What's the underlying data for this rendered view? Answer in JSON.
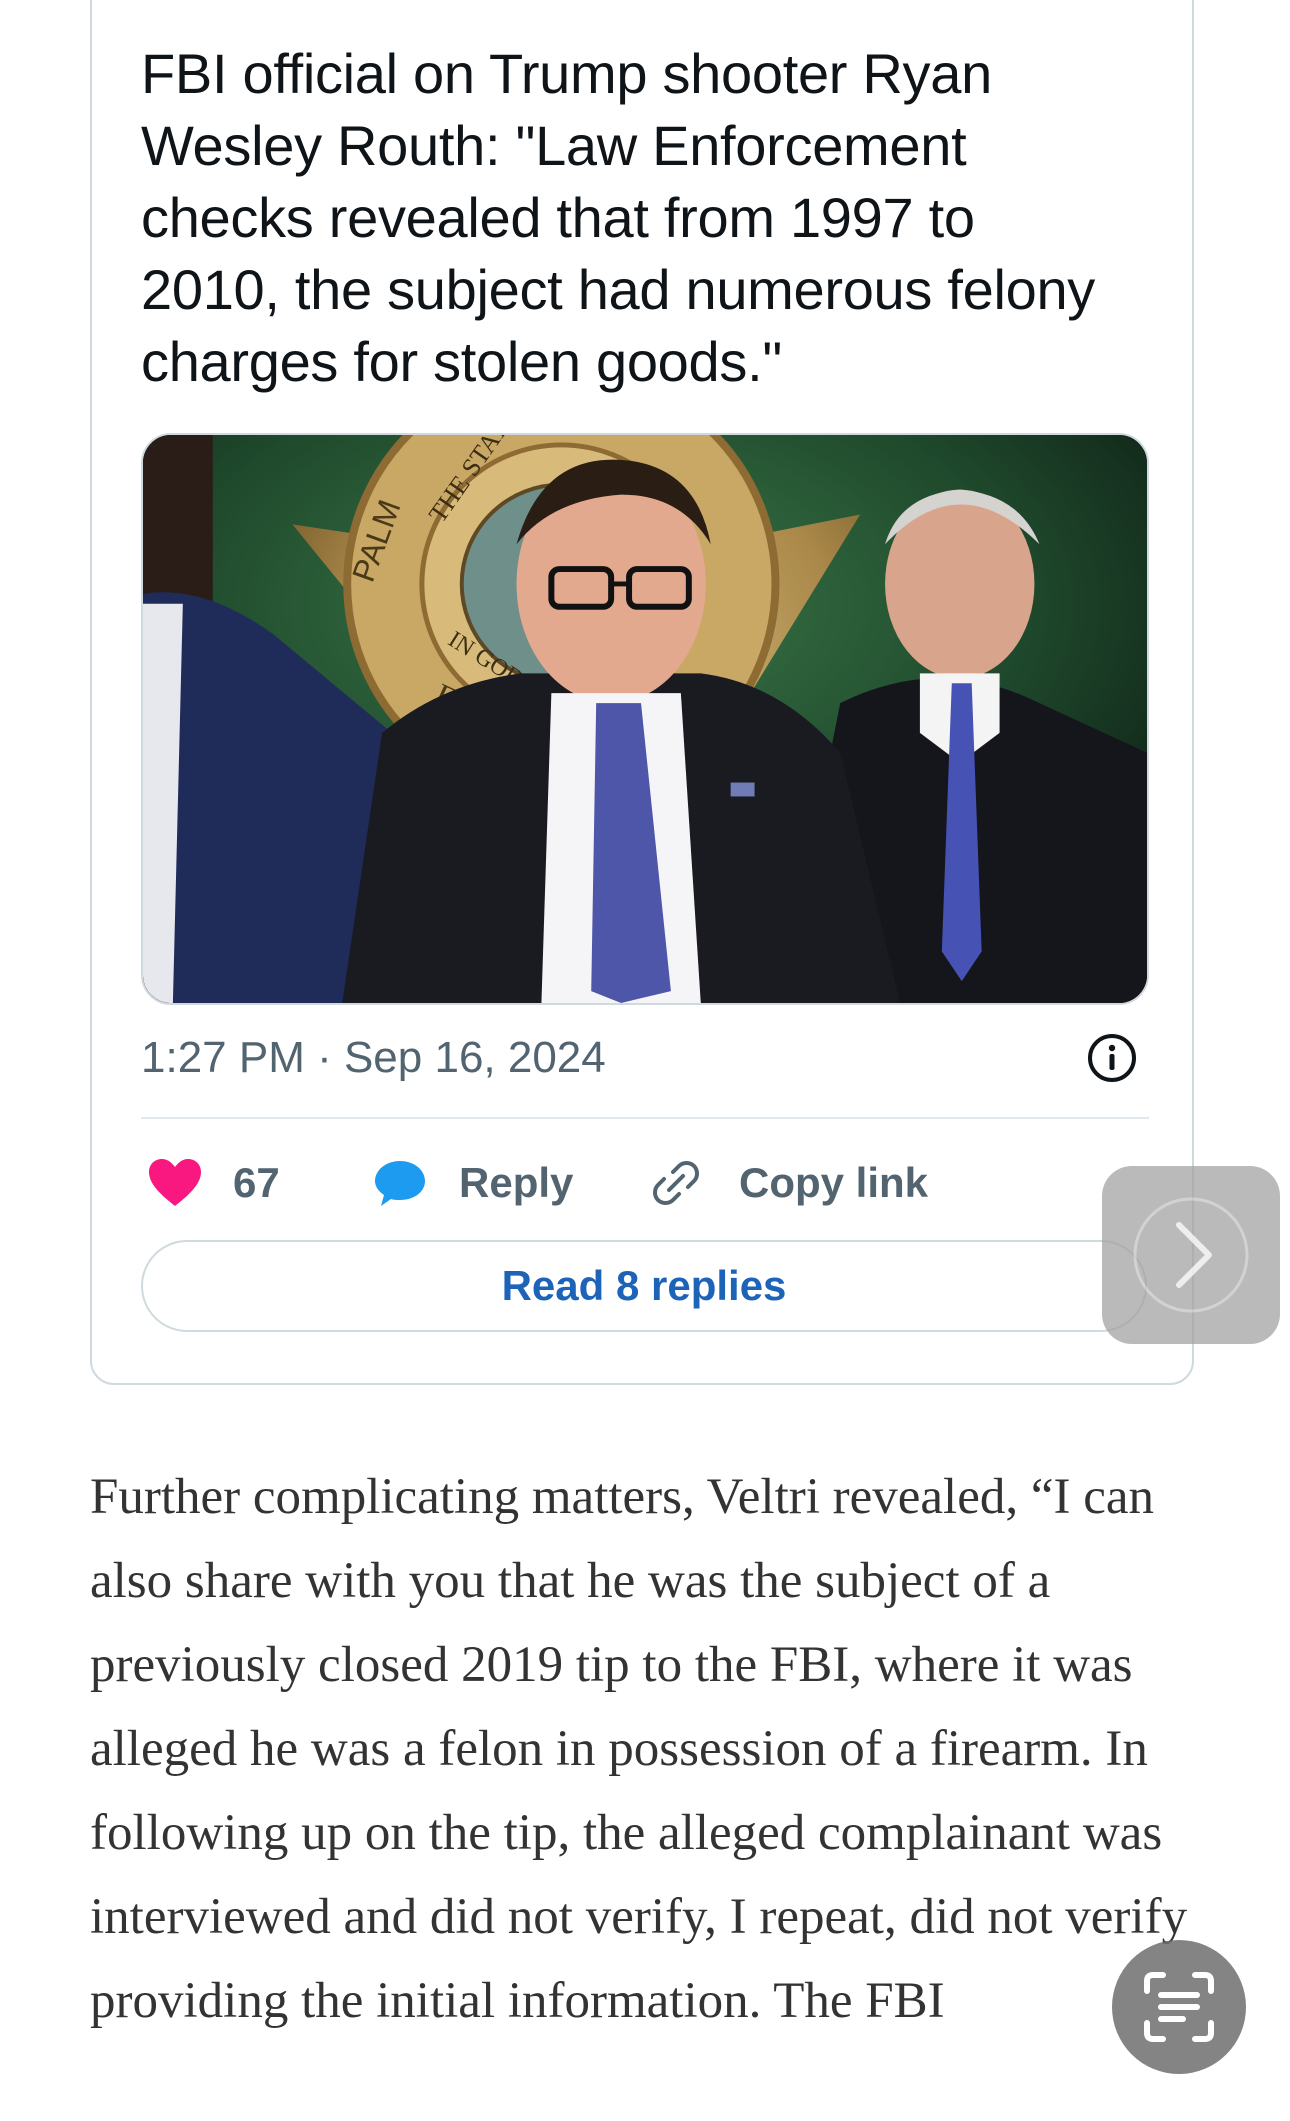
{
  "tweet": {
    "text": "FBI official on Trump shooter Ryan Wesley Routh: \"Law Enforcement checks revealed that from 1997 to 2010, the subject had numerous felony charges for stolen goods.\"",
    "timestamp": "1:27 PM · Sep 16, 2024",
    "media_icon": "press-conference-photo",
    "info_icon": "info-icon",
    "actions": {
      "like_count": "67",
      "reply_label": "Reply",
      "copy_link_label": "Copy link"
    },
    "read_replies_label": "Read 8 replies",
    "colors": {
      "like": "#f91880",
      "reply": "#1d9bf0",
      "read_replies": "#1d63b8",
      "secondary_text": "#536471",
      "border": "#cfd9de"
    }
  },
  "article": {
    "paragraph": "Further complicating matters, Veltri revealed, “I can also share with you that he was the subject of a previously closed 2019 tip to the FBI, where it was alleged he was a felon in possession of a firearm. In following up on the tip, the alleged complainant was interviewed and did not verify, I repeat, did not verify providing the initial information. The FBI",
    "color": "#333333"
  },
  "overlays": {
    "next_icon": "chevron-right-icon",
    "scan_icon": "text-scan-icon"
  },
  "seal_text": {
    "top": "THE STATE OF FL",
    "bottom": "IN GOD W",
    "left": "PALM",
    "lower": "FLO"
  }
}
